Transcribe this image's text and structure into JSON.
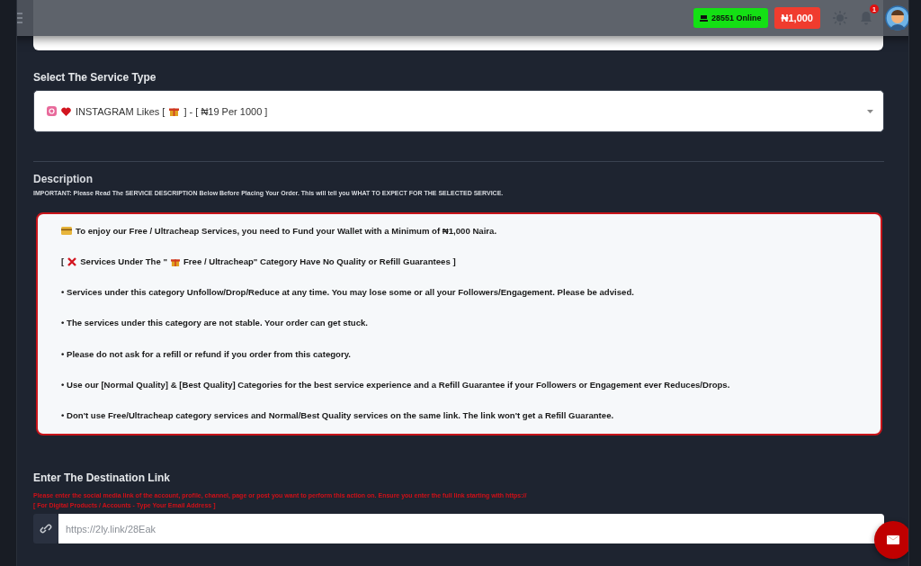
{
  "header": {
    "online": "28551 Online",
    "balance": "₦1,000",
    "notifications": "1"
  },
  "service": {
    "label": "Select The Service Type",
    "before": "INSTAGRAM Likes [",
    "after": "] - [ ₦19 Per 1000 ]"
  },
  "description": {
    "title": "Description",
    "notice": "IMPORTANT: Please Read The SERVICE DESCRIPTION Below Before Placing Your Order. This will tell you WHAT TO EXPECT FOR THE SELECTED SERVICE.",
    "lines": [
      {
        "kind": "wallet",
        "text": "To enjoy our Free / Ultracheap Services, you need to Fund your Wallet with a Minimum of ₦1,000 Naira."
      },
      {
        "kind": "warning",
        "before": "[",
        "middle": "Services Under The \"",
        "after": "Free / Ultracheap\" Category Have No Quality or Refill Guarantees ]"
      },
      {
        "kind": "plain",
        "text": "• Services under this category Unfollow/Drop/Reduce at any time. You may lose some or all your Followers/Engagement. Please be advised."
      },
      {
        "kind": "plain",
        "text": "• The services under this category are not stable. Your order can get stuck."
      },
      {
        "kind": "plain",
        "text": "• Please do not ask for a refill or refund if you order from this category."
      },
      {
        "kind": "plain",
        "text": "• Use our [Normal Quality] & [Best Quality] Categories for the best service experience and a Refill Guarantee if your Followers or Engagement ever Reduces/Drops."
      },
      {
        "kind": "plain",
        "text": "• Don't use Free/Ultracheap category services and Normal/Best Quality services on the same link. The link won't get a Refill Guarantee."
      }
    ]
  },
  "link": {
    "label": "Enter The Destination Link",
    "hint": "Please enter the social media link of the account, profile, channel, page or post you want to perform this action on. Ensure you enter the full link starting with https://",
    "hint2": "[ For Digital Products / Accounts - Type Your Email Address ]",
    "placeholder": "https://2ly.link/28Eak"
  }
}
